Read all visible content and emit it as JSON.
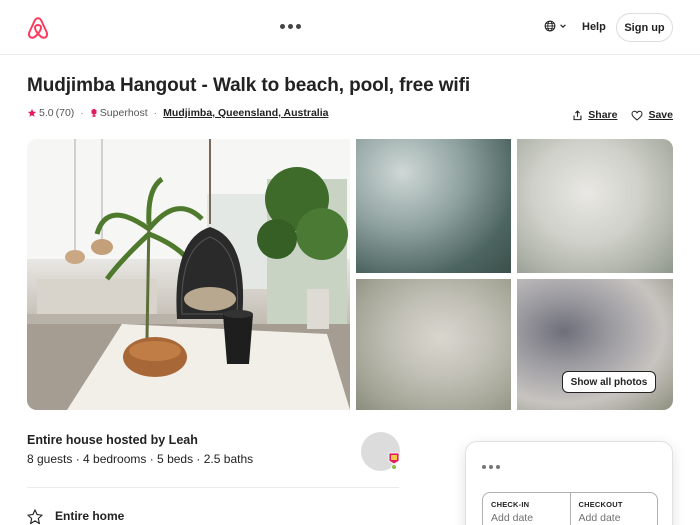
{
  "header": {
    "logo_icon": "airbnb-logo",
    "brand_color": "#FF385C",
    "menu_dots_icon": "more-dots-icon",
    "language_icon": "globe-icon",
    "help_label": "Help",
    "signup_label": "Sign up"
  },
  "listing": {
    "title": "Mudjimba Hangout - Walk to beach, pool, free wifi",
    "rating": "5.0",
    "review_count": "(70)",
    "superhost_label": "Superhost",
    "location": "Mudjimba, Queensland, Australia",
    "share_label": "Share",
    "save_label": "Save"
  },
  "gallery": {
    "show_all_label": "Show all photos"
  },
  "host": {
    "hosted_by": "Entire house hosted by Leah",
    "stats": "8 guests · 4 bedrooms · 5 beds · 2.5 baths"
  },
  "features": [
    {
      "icon": "star-outline-icon",
      "title": "Entire home"
    }
  ],
  "booking": {
    "checkin_label": "CHECK-IN",
    "checkin_placeholder": "Add date",
    "checkout_label": "CHECKOUT",
    "checkout_placeholder": "Add date"
  }
}
